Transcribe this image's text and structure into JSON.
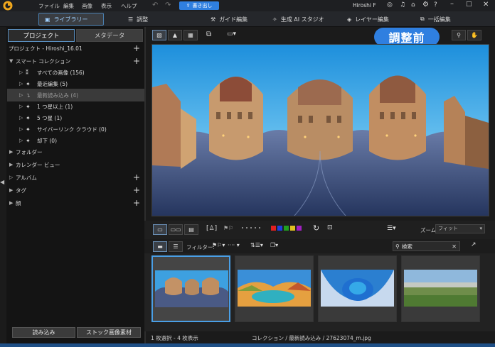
{
  "menu": {
    "items": [
      "ファイル",
      "編集",
      "画像",
      "表示",
      "ヘルプ"
    ],
    "write_label": "書き出し",
    "user_name": "Hiroshi F"
  },
  "modes": {
    "library": "ライブラリー",
    "adjust": "調整",
    "guided": "ガイド編集",
    "ai_studio": "生成 AI スタジオ",
    "layer": "レイヤー編集",
    "batch": "一括編集"
  },
  "left_panel": {
    "tabs": {
      "project": "プロジェクト",
      "metadata": "メタデータ"
    },
    "project_label": "プロジェクト - Hiroshi_16.01",
    "smart_collection": "スマート コレクション",
    "smart_items": [
      {
        "label": "すべての画像 (156)",
        "icon": "images-icon"
      },
      {
        "label": "最近編集 (5)",
        "icon": "sparkle-icon"
      },
      {
        "label": "最新読み込み (4)",
        "icon": "import-icon"
      },
      {
        "label": "1 つ星以上 (1)",
        "icon": "sparkle-icon"
      },
      {
        "label": "5 つ星 (1)",
        "icon": "sparkle-icon"
      },
      {
        "label": "サイバーリンク クラウド (0)",
        "icon": "sparkle-icon"
      },
      {
        "label": "却下 (0)",
        "icon": "sparkle-icon"
      }
    ],
    "folder": "フォルダー",
    "calendar": "カレンダー ビュー",
    "album": "アルバム",
    "tag": "タグ",
    "face": "顔",
    "import_button": "読み込み",
    "stock_button": "ストック画像素材"
  },
  "viewer": {
    "badge": "調整前"
  },
  "toolbar": {
    "zoom_label": "ズーム:",
    "zoom_value": "フィット",
    "filter_label": "フィルター:",
    "search_placeholder": "検索",
    "color_labels": [
      "#e02020",
      "#2040e0",
      "#20a020",
      "#e0c020",
      "#a020c0"
    ]
  },
  "status": {
    "left": "1 枚選択 - 4 枚表示",
    "center": "コレクション / 最新読み込み / 27623074_m.jpg"
  },
  "colors": {
    "accent": "#2f7fe0",
    "selection": "#4a9fe6"
  }
}
